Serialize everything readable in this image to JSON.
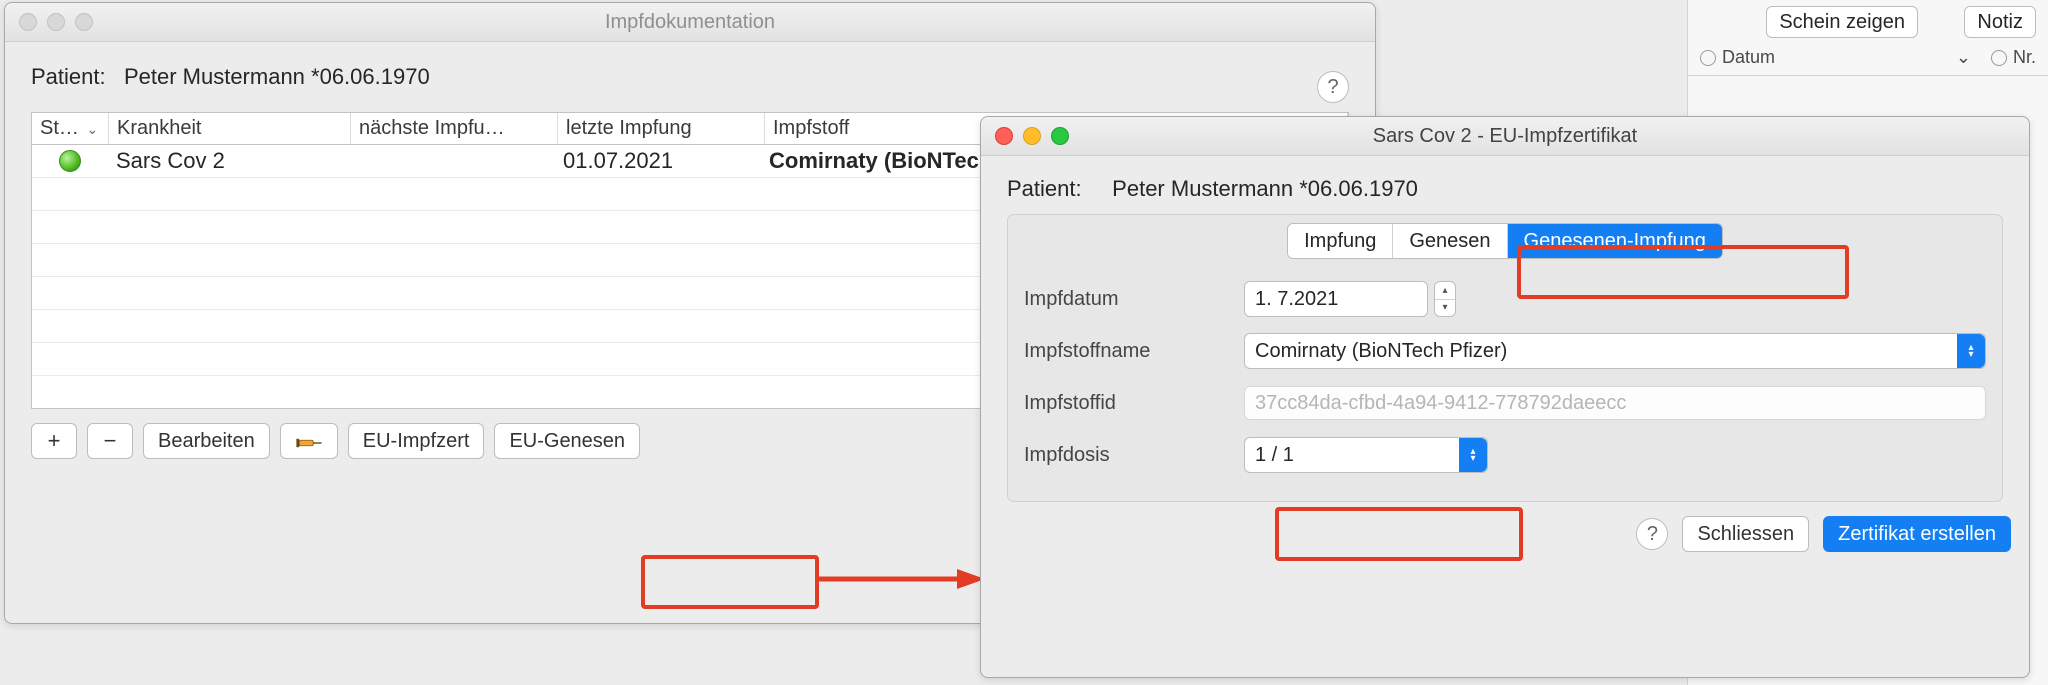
{
  "bg": {
    "schein_btn": "Schein zeigen",
    "notiz_btn": "Notiz",
    "col_datum": "Datum",
    "col_nr": "Nr."
  },
  "winA": {
    "title": "Impfdokumentation",
    "patient_label": "Patient:",
    "patient_value": "Peter Mustermann *06.06.1970",
    "help": "?",
    "cols": {
      "status": "St…",
      "krankheit": "Krankheit",
      "naechste": "nächste Impfu…",
      "letzte": "letzte Impfung",
      "impfstoff": "Impfstoff"
    },
    "row": {
      "krankheit": "Sars Cov 2",
      "naechste": "",
      "letzte": "01.07.2021",
      "impfstoff": "Comirnaty (BioNTec"
    },
    "toolbar": {
      "add": "+",
      "remove": "−",
      "bearbeiten": "Bearbeiten",
      "eu_impfzert": "EU-Impfzert",
      "eu_genesen": "EU-Genesen"
    }
  },
  "winB": {
    "title": "Sars Cov 2 - EU-Impfzertifikat",
    "patient_label": "Patient:",
    "patient_value": "Peter Mustermann *06.06.1970",
    "tabs": {
      "impfung": "Impfung",
      "genesen": "Genesen",
      "genesen_impfung": "Genesenen-Impfung"
    },
    "form": {
      "impfdatum_label": "Impfdatum",
      "impfdatum_value": "1.  7.2021",
      "name_label": "Impfstoffname",
      "name_value": "Comirnaty (BioNTech Pfizer)",
      "id_label": "Impfstoffid",
      "id_value": "37cc84da-cfbd-4a94-9412-778792daeecc",
      "dosis_label": "Impfdosis",
      "dosis_value": "1 / 1"
    },
    "actions": {
      "help": "?",
      "close": "Schliessen",
      "create": "Zertifikat erstellen"
    }
  }
}
